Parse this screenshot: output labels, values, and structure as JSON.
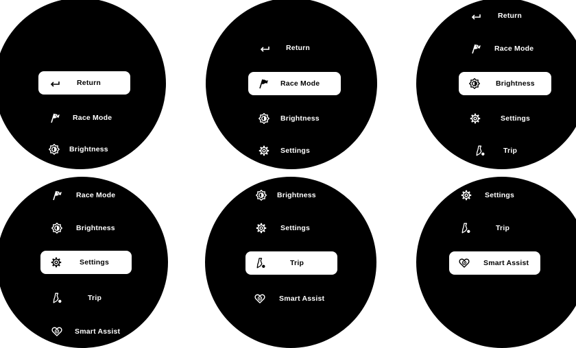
{
  "labels": {
    "return": "Return",
    "race_mode": "Race Mode",
    "brightness": "Brightness",
    "settings": "Settings",
    "trip": "Trip",
    "smart_assist": "Smart Assist"
  },
  "screens": [
    {
      "selected": "return"
    },
    {
      "selected": "race_mode"
    },
    {
      "selected": "brightness"
    },
    {
      "selected": "settings"
    },
    {
      "selected": "trip"
    },
    {
      "selected": "smart_assist"
    }
  ],
  "icons": {
    "return": "return-arrow-icon",
    "race_mode": "checkered-flag-icon",
    "brightness": "brightness-icon",
    "settings": "gear-icon",
    "trip": "trip-map-icon",
    "smart_assist": "heart-assist-icon"
  },
  "colors": {
    "screen_bg": "#000000",
    "text": "#ffffff",
    "highlight_bg": "#ffffff",
    "highlight_text": "#000000"
  }
}
